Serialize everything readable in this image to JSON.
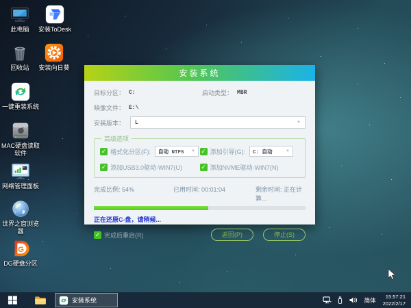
{
  "desktop": {
    "icons": [
      {
        "name": "this-pc",
        "label": "此电脑"
      },
      {
        "name": "install-todesk",
        "label": "安装ToDesk"
      },
      {
        "name": "recycle-bin",
        "label": "回收站"
      },
      {
        "name": "install-sunflower",
        "label": "安装向日葵"
      },
      {
        "name": "one-key-reinstall",
        "label": "一键重装系统"
      },
      {
        "name": "mac-disk-reader",
        "label": "MAC硬盘读取软件"
      },
      {
        "name": "network-panel",
        "label": "网络管理面板"
      },
      {
        "name": "world-window-browser",
        "label": "世界之窗浏览器"
      },
      {
        "name": "dg-partition",
        "label": "DG硬盘分区"
      }
    ]
  },
  "dialog": {
    "title": "安装系统",
    "fields": {
      "target_partition_label": "目标分区：",
      "target_partition_value": "C:",
      "boot_type_label": "启动类型：",
      "boot_type_value": "MBR",
      "image_file_label": "映像文件：",
      "image_file_value": "E:\\",
      "install_version_label": "安装版本：",
      "install_version_value": "L"
    },
    "advanced": {
      "legend": "高级选项",
      "format_label": "格式化分区(F):",
      "format_value": "自动 NTFS",
      "boot_label": "添加引导(G):",
      "boot_value": "C: 自动",
      "usb3_label": "添加USB3.0驱动-WIN7(U)",
      "nvme_label": "添加NVME驱动-WIN7(N)",
      "check_glyph": "✓"
    },
    "progress": {
      "percent_text": "完成比例: 54%",
      "percent_value": 54,
      "elapsed_text": "已用时间: 00:01:04",
      "remaining_text": "剩余时间: 正在计算...",
      "status_text": "正在还原C-盘，请稍候...",
      "restart_label": "完成后重启(R)",
      "back_button": "返回(P)",
      "stop_button": "停止(S)"
    },
    "colors": {
      "accent_green": "#45c226",
      "title_gradient_left": "#b6d214",
      "title_gradient_right": "#1ab3e8",
      "status_blue": "#2336d0"
    }
  },
  "taskbar": {
    "task_label": "安装系统",
    "tray": {
      "input_method": "简体",
      "time": "15:57:21",
      "date": "2022/2/17"
    }
  }
}
